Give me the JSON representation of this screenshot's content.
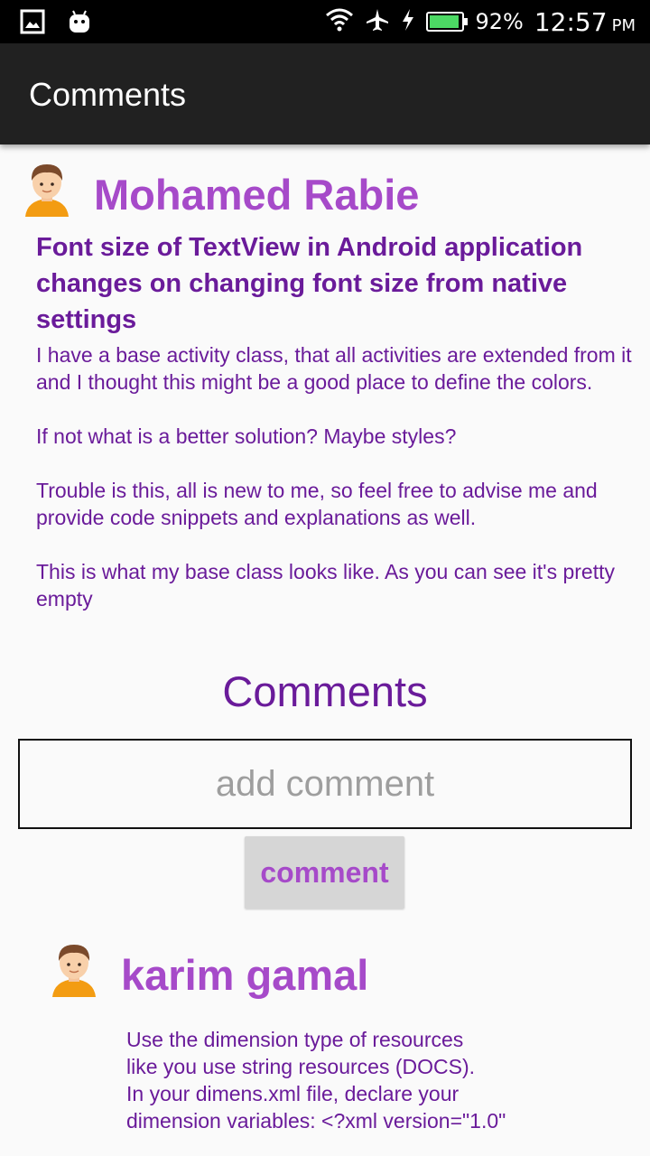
{
  "status_bar": {
    "battery_percent": "92%",
    "battery_level": 0.92,
    "time": "12:57",
    "ampm": "PM",
    "icons": [
      "gallery-icon",
      "android-icon",
      "wifi-icon",
      "airplane-icon",
      "charging-icon",
      "battery-icon"
    ]
  },
  "app_bar": {
    "title": "Comments"
  },
  "post": {
    "author": "Mohamed Rabie",
    "title": "Font size of TextView in Android application changes on changing font size from native settings",
    "body": "I have a base activity class, that all activities are extended from it and I thought this might be a good place to define the colors.\n\nIf not what is a better solution? Maybe styles?\n\nTrouble is this, all is new to me, so feel free to advise me and provide code snippets and explanations as well.\n\nThis is what my base class looks like. As you can see it's pretty empty"
  },
  "comments_section": {
    "title": "Comments",
    "input_placeholder": "add comment",
    "button_label": "comment"
  },
  "comments": [
    {
      "author": "karim gamal",
      "text": "Use the dimension type of resources\nlike you use string resources (DOCS).\nIn your dimens.xml file, declare your\ndimension variables:  <?xml version=\"1.0\""
    }
  ],
  "colors": {
    "status_bar": "#000000",
    "app_bar": "#212121",
    "accent": "#a64ac9",
    "primary_text": "#6a1b9a",
    "background": "#fafafa"
  }
}
